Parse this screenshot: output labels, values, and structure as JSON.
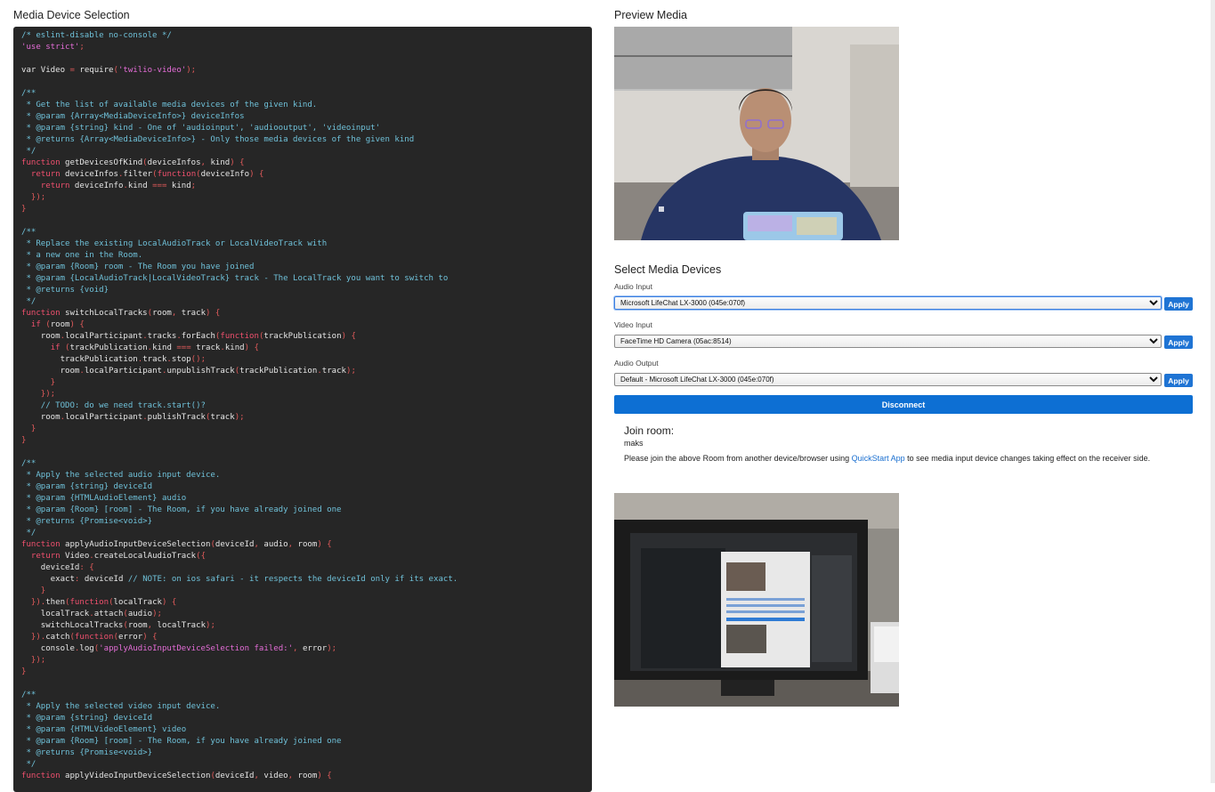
{
  "left": {
    "title": "Media Device Selection"
  },
  "code_lines": [
    [
      [
        "c",
        "/* eslint-disable no-console */"
      ]
    ],
    [
      [
        "s",
        "'use strict'"
      ],
      [
        "p",
        ";"
      ]
    ],
    [],
    [
      [
        "t",
        "var Video "
      ],
      [
        "p",
        "="
      ],
      [
        "t",
        " require"
      ],
      [
        "p",
        "("
      ],
      [
        "s",
        "'twilio-video'"
      ],
      [
        "p",
        ");"
      ]
    ],
    [],
    [
      [
        "c",
        "/**"
      ]
    ],
    [
      [
        "c",
        " * Get the list of available media devices of the given kind."
      ]
    ],
    [
      [
        "c",
        " * @param {Array<MediaDeviceInfo>} deviceInfos"
      ]
    ],
    [
      [
        "c",
        " * @param {string} kind - One of 'audioinput', 'audiooutput', 'videoinput'"
      ]
    ],
    [
      [
        "c",
        " * @returns {Array<MediaDeviceInfo>} - Only those media devices of the given kind"
      ]
    ],
    [
      [
        "c",
        " */"
      ]
    ],
    [
      [
        "k",
        "function"
      ],
      [
        "t",
        " getDevicesOfKind"
      ],
      [
        "p",
        "("
      ],
      [
        "t",
        "deviceInfos"
      ],
      [
        "p",
        ", "
      ],
      [
        "t",
        "kind"
      ],
      [
        "p",
        ") {"
      ]
    ],
    [
      [
        "t",
        "  "
      ],
      [
        "k",
        "return"
      ],
      [
        "t",
        " deviceInfos"
      ],
      [
        "p",
        "."
      ],
      [
        "t",
        "filter"
      ],
      [
        "p",
        "("
      ],
      [
        "k",
        "function"
      ],
      [
        "p",
        "("
      ],
      [
        "t",
        "deviceInfo"
      ],
      [
        "p",
        ") {"
      ]
    ],
    [
      [
        "t",
        "    "
      ],
      [
        "k",
        "return"
      ],
      [
        "t",
        " deviceInfo"
      ],
      [
        "p",
        "."
      ],
      [
        "t",
        "kind "
      ],
      [
        "p",
        "==="
      ],
      [
        "t",
        " kind"
      ],
      [
        "p",
        ";"
      ]
    ],
    [
      [
        "p",
        "  });"
      ]
    ],
    [
      [
        "p",
        "}"
      ]
    ],
    [],
    [
      [
        "c",
        "/**"
      ]
    ],
    [
      [
        "c",
        " * Replace the existing LocalAudioTrack or LocalVideoTrack with"
      ]
    ],
    [
      [
        "c",
        " * a new one in the Room."
      ]
    ],
    [
      [
        "c",
        " * @param {Room} room - The Room you have joined"
      ]
    ],
    [
      [
        "c",
        " * @param {LocalAudioTrack|LocalVideoTrack} track - The LocalTrack you want to switch to"
      ]
    ],
    [
      [
        "c",
        " * @returns {void}"
      ]
    ],
    [
      [
        "c",
        " */"
      ]
    ],
    [
      [
        "k",
        "function"
      ],
      [
        "t",
        " switchLocalTracks"
      ],
      [
        "p",
        "("
      ],
      [
        "t",
        "room"
      ],
      [
        "p",
        ", "
      ],
      [
        "t",
        "track"
      ],
      [
        "p",
        ") {"
      ]
    ],
    [
      [
        "t",
        "  "
      ],
      [
        "k",
        "if"
      ],
      [
        "p",
        " ("
      ],
      [
        "t",
        "room"
      ],
      [
        "p",
        ") {"
      ]
    ],
    [
      [
        "t",
        "    room"
      ],
      [
        "p",
        "."
      ],
      [
        "t",
        "localParticipant"
      ],
      [
        "p",
        "."
      ],
      [
        "t",
        "tracks"
      ],
      [
        "p",
        "."
      ],
      [
        "t",
        "forEach"
      ],
      [
        "p",
        "("
      ],
      [
        "k",
        "function"
      ],
      [
        "p",
        "("
      ],
      [
        "t",
        "trackPublication"
      ],
      [
        "p",
        ") {"
      ]
    ],
    [
      [
        "t",
        "      "
      ],
      [
        "k",
        "if"
      ],
      [
        "p",
        " ("
      ],
      [
        "t",
        "trackPublication"
      ],
      [
        "p",
        "."
      ],
      [
        "t",
        "kind "
      ],
      [
        "p",
        "==="
      ],
      [
        "t",
        " track"
      ],
      [
        "p",
        "."
      ],
      [
        "t",
        "kind"
      ],
      [
        "p",
        ") {"
      ]
    ],
    [
      [
        "t",
        "        trackPublication"
      ],
      [
        "p",
        "."
      ],
      [
        "t",
        "track"
      ],
      [
        "p",
        "."
      ],
      [
        "t",
        "stop"
      ],
      [
        "p",
        "();"
      ]
    ],
    [
      [
        "t",
        "        room"
      ],
      [
        "p",
        "."
      ],
      [
        "t",
        "localParticipant"
      ],
      [
        "p",
        "."
      ],
      [
        "t",
        "unpublishTrack"
      ],
      [
        "p",
        "("
      ],
      [
        "t",
        "trackPublication"
      ],
      [
        "p",
        "."
      ],
      [
        "t",
        "track"
      ],
      [
        "p",
        ");"
      ]
    ],
    [
      [
        "p",
        "      }"
      ]
    ],
    [
      [
        "p",
        "    });"
      ]
    ],
    [
      [
        "c",
        "    // TODO: do we need track.start()?"
      ]
    ],
    [
      [
        "t",
        "    room"
      ],
      [
        "p",
        "."
      ],
      [
        "t",
        "localParticipant"
      ],
      [
        "p",
        "."
      ],
      [
        "t",
        "publishTrack"
      ],
      [
        "p",
        "("
      ],
      [
        "t",
        "track"
      ],
      [
        "p",
        ");"
      ]
    ],
    [
      [
        "p",
        "  }"
      ]
    ],
    [
      [
        "p",
        "}"
      ]
    ],
    [],
    [
      [
        "c",
        "/**"
      ]
    ],
    [
      [
        "c",
        " * Apply the selected audio input device."
      ]
    ],
    [
      [
        "c",
        " * @param {string} deviceId"
      ]
    ],
    [
      [
        "c",
        " * @param {HTMLAudioElement} audio"
      ]
    ],
    [
      [
        "c",
        " * @param {Room} [room] - The Room, if you have already joined one"
      ]
    ],
    [
      [
        "c",
        " * @returns {Promise<void>}"
      ]
    ],
    [
      [
        "c",
        " */"
      ]
    ],
    [
      [
        "k",
        "function"
      ],
      [
        "t",
        " applyAudioInputDeviceSelection"
      ],
      [
        "p",
        "("
      ],
      [
        "t",
        "deviceId"
      ],
      [
        "p",
        ", "
      ],
      [
        "t",
        "audio"
      ],
      [
        "p",
        ", "
      ],
      [
        "t",
        "room"
      ],
      [
        "p",
        ") {"
      ]
    ],
    [
      [
        "t",
        "  "
      ],
      [
        "k",
        "return"
      ],
      [
        "t",
        " Video"
      ],
      [
        "p",
        "."
      ],
      [
        "t",
        "createLocalAudioTrack"
      ],
      [
        "p",
        "({"
      ]
    ],
    [
      [
        "t",
        "    deviceId"
      ],
      [
        "p",
        ": {"
      ]
    ],
    [
      [
        "t",
        "      exact"
      ],
      [
        "p",
        ": "
      ],
      [
        "t",
        "deviceId "
      ],
      [
        "c",
        "// NOTE: on ios safari - it respects the deviceId only if its exact."
      ]
    ],
    [
      [
        "p",
        "    }"
      ]
    ],
    [
      [
        "p",
        "  })."
      ],
      [
        "t",
        "then"
      ],
      [
        "p",
        "("
      ],
      [
        "k",
        "function"
      ],
      [
        "p",
        "("
      ],
      [
        "t",
        "localTrack"
      ],
      [
        "p",
        ") {"
      ]
    ],
    [
      [
        "t",
        "    localTrack"
      ],
      [
        "p",
        "."
      ],
      [
        "t",
        "attach"
      ],
      [
        "p",
        "("
      ],
      [
        "t",
        "audio"
      ],
      [
        "p",
        ");"
      ]
    ],
    [
      [
        "t",
        "    switchLocalTracks"
      ],
      [
        "p",
        "("
      ],
      [
        "t",
        "room"
      ],
      [
        "p",
        ", "
      ],
      [
        "t",
        "localTrack"
      ],
      [
        "p",
        ");"
      ]
    ],
    [
      [
        "p",
        "  })."
      ],
      [
        "t",
        "catch"
      ],
      [
        "p",
        "("
      ],
      [
        "k",
        "function"
      ],
      [
        "p",
        "("
      ],
      [
        "t",
        "error"
      ],
      [
        "p",
        ") {"
      ]
    ],
    [
      [
        "t",
        "    console"
      ],
      [
        "p",
        "."
      ],
      [
        "t",
        "log"
      ],
      [
        "p",
        "("
      ],
      [
        "s",
        "'applyAudioInputDeviceSelection failed:'"
      ],
      [
        "p",
        ", "
      ],
      [
        "t",
        "error"
      ],
      [
        "p",
        ");"
      ]
    ],
    [
      [
        "p",
        "  });"
      ]
    ],
    [
      [
        "p",
        "}"
      ]
    ],
    [],
    [
      [
        "c",
        "/**"
      ]
    ],
    [
      [
        "c",
        " * Apply the selected video input device."
      ]
    ],
    [
      [
        "c",
        " * @param {string} deviceId"
      ]
    ],
    [
      [
        "c",
        " * @param {HTMLVideoElement} video"
      ]
    ],
    [
      [
        "c",
        " * @param {Room} [room] - The Room, if you have already joined one"
      ]
    ],
    [
      [
        "c",
        " * @returns {Promise<void>}"
      ]
    ],
    [
      [
        "c",
        " */"
      ]
    ],
    [
      [
        "k",
        "function"
      ],
      [
        "t",
        " applyVideoInputDeviceSelection"
      ],
      [
        "p",
        "("
      ],
      [
        "t",
        "deviceId"
      ],
      [
        "p",
        ", "
      ],
      [
        "t",
        "video"
      ],
      [
        "p",
        ", "
      ],
      [
        "t",
        "room"
      ],
      [
        "p",
        ") {"
      ]
    ]
  ],
  "right": {
    "preview_title": "Preview Media",
    "select_title": "Select Media Devices",
    "audio_input": {
      "label": "Audio Input",
      "value": "Microsoft LifeChat LX-3000 (045e:070f)"
    },
    "video_input": {
      "label": "Video Input",
      "value": "FaceTime HD Camera (05ac:8514)"
    },
    "audio_output": {
      "label": "Audio Output",
      "value": "Default - Microsoft LifeChat LX-3000 (045e:070f)"
    },
    "apply_label": "Apply",
    "disconnect_label": "Disconnect",
    "join_heading": "Join room:",
    "room_name": "maks",
    "join_text_before": "Please join the above Room from another device/browser using ",
    "join_link": "QuickStart App",
    "join_text_after": " to see media input device changes taking effect on the receiver side."
  },
  "colors": {
    "accent": "#1f74d4",
    "code_bg": "#262626",
    "comment": "#6fc1d9",
    "string": "#e56dd8",
    "keyword": "#f0506e"
  }
}
